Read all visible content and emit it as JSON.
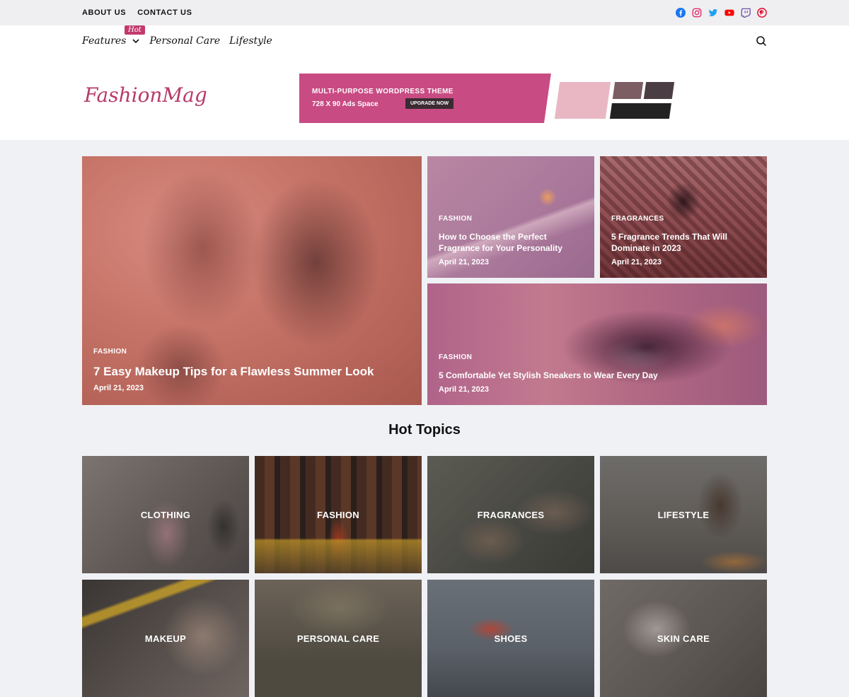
{
  "topbar": {
    "links": [
      "ABOUT US",
      "CONTACT US"
    ],
    "social_icons": [
      "facebook-icon",
      "instagram-icon",
      "twitter-icon",
      "youtube-icon",
      "twitch-icon",
      "pinterest-icon"
    ]
  },
  "nav": {
    "items": [
      "Features",
      "Personal Care",
      "Lifestyle"
    ],
    "hot_badge": "Hot",
    "search_icon": "search-icon"
  },
  "brand": {
    "logo": "FashionMag",
    "color": "#b83a68"
  },
  "ad": {
    "line1": "MULTI-PURPOSE WORDPRESS THEME",
    "line2": "728 X 90 Ads Space",
    "button": "UPGRADE NOW"
  },
  "featured": [
    {
      "category": "FASHION",
      "title": "7 Easy Makeup Tips for a Flawless Summer Look",
      "date": "April 21, 2023"
    },
    {
      "category": "FASHION",
      "title": "How to Choose the Perfect Fragrance for Your Personality",
      "date": "April 21, 2023"
    },
    {
      "category": "FRAGRANCES",
      "title": "5 Fragrance Trends That Will Dominate in 2023",
      "date": "April 21, 2023"
    },
    {
      "category": "FASHION",
      "title": "5 Comfortable Yet Stylish Sneakers to Wear Every Day",
      "date": "April 21, 2023"
    }
  ],
  "hot_topics": {
    "heading": "Hot Topics",
    "items": [
      "CLOTHING",
      "FASHION",
      "FRAGRANCES",
      "LIFESTYLE",
      "MAKEUP",
      "PERSONAL CARE",
      "SHOES",
      "SKIN CARE"
    ]
  },
  "colors": {
    "accent": "#c23a6c",
    "overlay_pink": "#c25a7a"
  }
}
